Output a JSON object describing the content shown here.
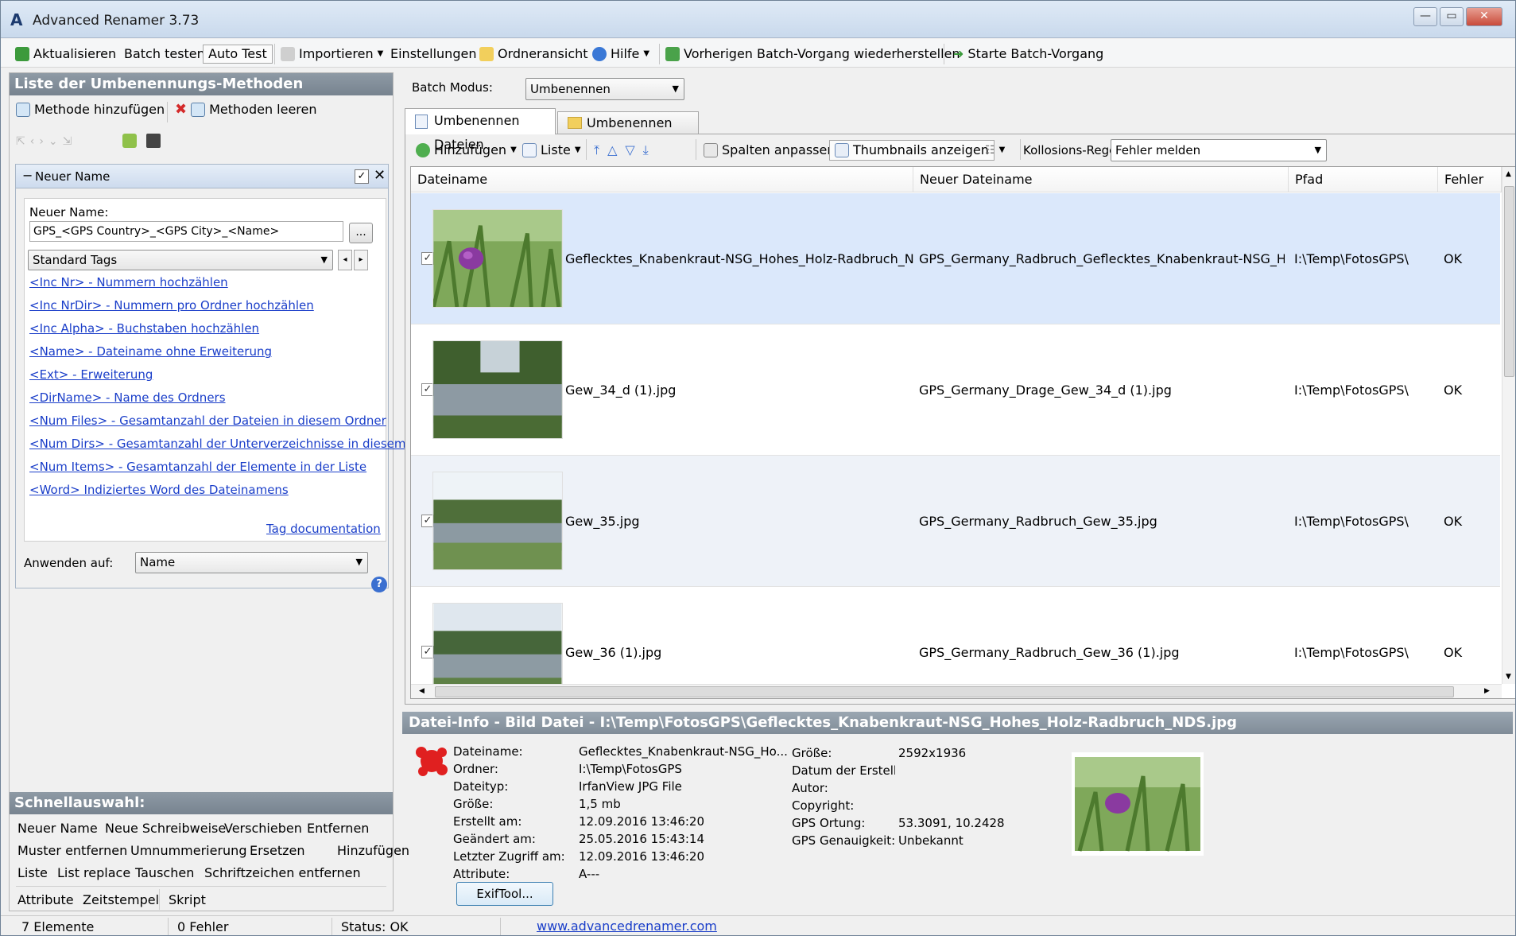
{
  "window": {
    "title": "Advanced Renamer 3.73",
    "buttons": {
      "minimize": "—",
      "maximize": "▭",
      "close": "✕"
    }
  },
  "toolbar": {
    "refresh": "Aktualisieren",
    "batch_test": "Batch testen",
    "auto_test": "Auto Test",
    "import": "Importieren",
    "settings": "Einstellungen",
    "folder_view": "Ordneransicht",
    "help": "Hilfe",
    "restore": "Vorherigen Batch-Vorgang wiederherstellen",
    "start": "Starte Batch-Vorgang"
  },
  "methods_panel": {
    "title": "Liste der Umbenennungs-Methoden",
    "add_method": "Methode hinzufügen",
    "clear_methods": "Methoden leeren",
    "method": {
      "header": "Neuer Name",
      "label": "Neuer Name:",
      "pattern": "GPS_<GPS Country>_<GPS City>_<Name>",
      "browse": "...",
      "tags_dropdown": "Standard Tags",
      "tags": [
        "<Inc Nr> - Nummern hochzählen",
        "<Inc NrDir> - Nummern pro Ordner hochzählen",
        "<Inc Alpha> - Buchstaben hochzählen",
        "<Name> - Dateiname ohne Erweiterung",
        "<Ext> - Erweiterung",
        "<DirName> - Name des Ordners",
        "<Num Files> - Gesamtanzahl der Dateien in diesem Ordner",
        "<Num Dirs> - Gesamtanzahl der Unterverzeichnisse in diesem O",
        "<Num Items> - Gesamtanzahl der Elemente in der Liste",
        "<Word> Indiziertes Word des Dateinamens"
      ],
      "tag_doc": "Tag documentation",
      "apply_label": "Anwenden auf:",
      "apply_value": "Name"
    }
  },
  "quick": {
    "title": "Schnellauswahl:",
    "row1": [
      "Neuer Name",
      "Neue Schreibweise",
      "Verschieben",
      "Entfernen"
    ],
    "row2": [
      "Muster entfernen",
      "Umnummerierung",
      "Ersetzen",
      "Hinzufügen"
    ],
    "row3": [
      "Liste",
      "List replace",
      "Tauschen",
      "Schriftzeichen entfernen"
    ],
    "row4": [
      "Attribute",
      "Zeitstempel",
      "Skript"
    ]
  },
  "batch": {
    "mode_label": "Batch Modus:",
    "mode_value": "Umbenennen",
    "tab_files": "Umbenennen Dateien",
    "tab_folders": "Umbenennen Ordner"
  },
  "list_toolbar": {
    "add": "Hinzufügen",
    "list": "Liste",
    "fit_columns": "Spalten anpassen",
    "thumbnails": "Thumbnails anzeigen",
    "collision_label": "Kollosions-Regel:",
    "collision_value": "Fehler melden"
  },
  "columns": [
    "Dateiname",
    "Neuer Dateiname",
    "Pfad",
    "Fehler"
  ],
  "files": [
    {
      "name": "Geflecktes_Knabenkraut-NSG_Hohes_Holz-Radbruch_NDS.jpg",
      "new_name": "GPS_Germany_Radbruch_Geflecktes_Knabenkraut-NSG_Hohes_H...",
      "path": "I:\\Temp\\FotosGPS\\",
      "error": "OK",
      "checked": "✓"
    },
    {
      "name": "Gew_34_d (1).jpg",
      "new_name": "GPS_Germany_Drage_Gew_34_d (1).jpg",
      "path": "I:\\Temp\\FotosGPS\\",
      "error": "OK",
      "checked": "✓"
    },
    {
      "name": "Gew_35.jpg",
      "new_name": "GPS_Germany_Radbruch_Gew_35.jpg",
      "path": "I:\\Temp\\FotosGPS\\",
      "error": "OK",
      "checked": "✓"
    },
    {
      "name": "Gew_36 (1).jpg",
      "new_name": "GPS_Germany_Radbruch_Gew_36 (1).jpg",
      "path": "I:\\Temp\\FotosGPS\\",
      "error": "OK",
      "checked": "✓"
    }
  ],
  "info": {
    "header": "Datei-Info - Bild Datei - I:\\Temp\\FotosGPS\\Geflecktes_Knabenkraut-NSG_Hohes_Holz-Radbruch_NDS.jpg",
    "left": [
      {
        "k": "Dateiname:",
        "v": "Geflecktes_Knabenkraut-NSG_Ho..."
      },
      {
        "k": "Ordner:",
        "v": "I:\\Temp\\FotosGPS"
      },
      {
        "k": "Dateityp:",
        "v": "IrfanView JPG File"
      },
      {
        "k": "Größe:",
        "v": "1,5 mb"
      },
      {
        "k": "Erstellt am:",
        "v": "12.09.2016 13:46:20"
      },
      {
        "k": "Geändert am:",
        "v": "25.05.2016 15:43:14"
      },
      {
        "k": "Letzter Zugriff am:",
        "v": "12.09.2016 13:46:20"
      },
      {
        "k": "Attribute:",
        "v": "A---"
      }
    ],
    "right": [
      {
        "k": "Größe:",
        "v": "2592x1936"
      },
      {
        "k": "Datum der Erstellunç",
        "v": ""
      },
      {
        "k": "Autor:",
        "v": ""
      },
      {
        "k": "Copyright:",
        "v": ""
      },
      {
        "k": "GPS Ortung:",
        "v": "53.3091, 10.2428"
      },
      {
        "k": "GPS Genauigkeit:",
        "v": "Unbekannt"
      }
    ],
    "exif_button": "ExifTool..."
  },
  "status": {
    "items": "7 Elemente",
    "errors": "0 Fehler",
    "state": "Status: OK",
    "link": "www.advancedrenamer.com"
  },
  "colors": {
    "accent": "#1a3ec9",
    "panel_header": "#808c98",
    "selection": "#dbe8fb"
  }
}
